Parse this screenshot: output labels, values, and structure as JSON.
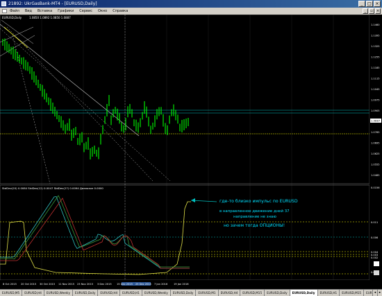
{
  "window": {
    "title": "21892: UkrGasBank-MT4 - [EURUSD,Daily]",
    "minimize": "_",
    "maximize": "□",
    "close": "×"
  },
  "menu": {
    "items": [
      "Файл",
      "Вид",
      "Вставка",
      "Графики",
      "Сервис",
      "Окно",
      "Справка"
    ],
    "mdi_min": "_",
    "mdi_restore": "▫",
    "mdi_close": "×"
  },
  "chart": {
    "header": "EURUSD,Daily",
    "ohlc": "1.0850 1.0892 1.0850 1.0887",
    "current_price": "1.0887",
    "price_levels": [
      "1.1460",
      "1.1395",
      "1.1325",
      "1.1255",
      "1.1185",
      "1.1115",
      "1.1045",
      "1.0975",
      "1.0905",
      "1.0835",
      "1.0765",
      "1.0695",
      "1.0625",
      "1.0555",
      "1.0485"
    ],
    "colors": {
      "background": "#000000",
      "bull": "#00ff00",
      "bear": "#00ff00",
      "grid": "#4a4a4a",
      "level": "#ffff00",
      "cyan_level": "#00c0c0"
    }
  },
  "indicator": {
    "header": "StdDev(20) 0.0084  StdDev(12) 0.0047  StdDev(27) 0.0094  Диапазон 0.0000",
    "scale": [
      "0.0156",
      "0.011",
      "0.006",
      "0.004",
      "0.003",
      "0.002",
      "0.000"
    ],
    "annotation_line1": "где-то близко импульс по EURUSD",
    "annotation_line2": "в направленное движение дней 37",
    "annotation_line3": "направление не знаю",
    "annotation_line4": "но зачем тогда ОПЦИОНЫ!",
    "annotation_color": "#00e0ff"
  },
  "time_axis": {
    "labels": [
      "8 Oct 2015",
      "20 Oct 2015",
      "30 Oct 2015",
      "11 Nov 2015",
      "23 Nov 2015",
      "3 Dec 2015",
      "15 Dec 2015",
      "25 Dec 2015",
      "7 Jan 2016",
      "19 Jan 2016"
    ]
  },
  "tabs": {
    "items": [
      "EURUSD,M5",
      "EURUSD,H4",
      "EURUSD,Weekly",
      "EURUSD,Daily",
      "EURUSD,H4",
      "EURUSD,H1",
      "EURUSD,Weekly",
      "EURUSD,Daily",
      "EURUSD,M1",
      "EURUSD,H4",
      "EURUSD,M15",
      "EURUSD,Daily",
      "EURUSD,Daily",
      "EURUSD,H1",
      "EURUSD,M15",
      "EURUSD,H1"
    ],
    "active_index": 12,
    "nav_left": "◂",
    "nav_right": "▸"
  }
}
